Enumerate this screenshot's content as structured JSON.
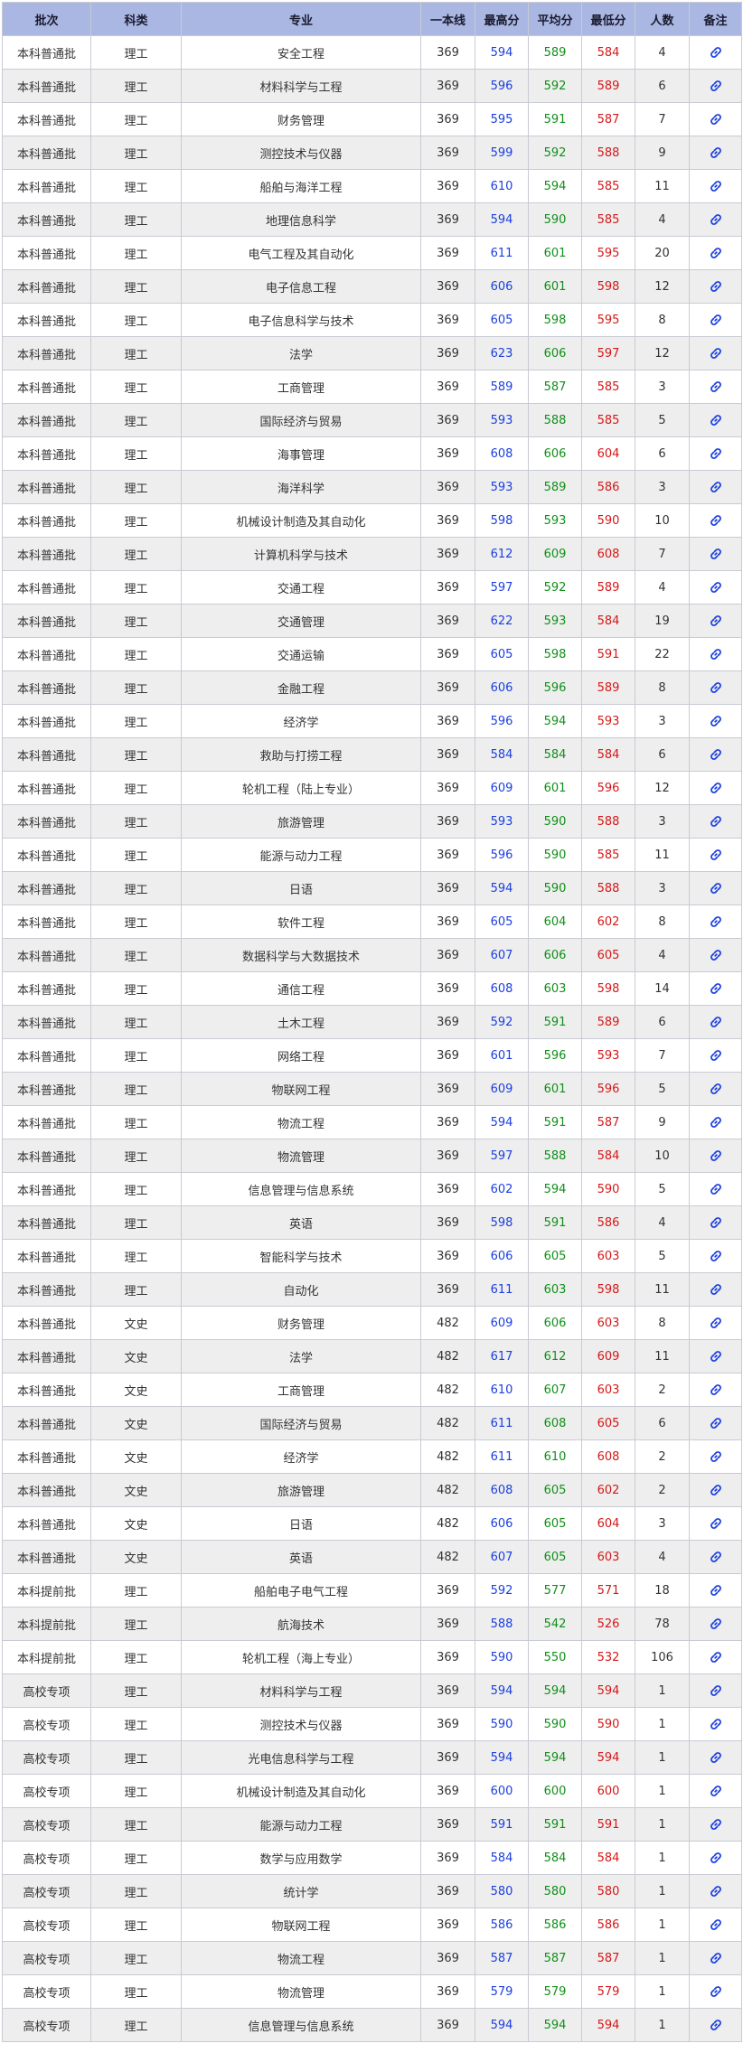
{
  "table": {
    "headers": {
      "batch": "批次",
      "category": "科类",
      "major": "专业",
      "line": "一本线",
      "max": "最高分",
      "avg": "平均分",
      "min": "最低分",
      "count": "人数",
      "note": "备注"
    },
    "rows": [
      {
        "batch": "本科普通批",
        "category": "理工",
        "major": "安全工程",
        "line": "369",
        "max": "594",
        "avg": "589",
        "min": "584",
        "count": "4"
      },
      {
        "batch": "本科普通批",
        "category": "理工",
        "major": "材料科学与工程",
        "line": "369",
        "max": "596",
        "avg": "592",
        "min": "589",
        "count": "6"
      },
      {
        "batch": "本科普通批",
        "category": "理工",
        "major": "财务管理",
        "line": "369",
        "max": "595",
        "avg": "591",
        "min": "587",
        "count": "7"
      },
      {
        "batch": "本科普通批",
        "category": "理工",
        "major": "测控技术与仪器",
        "line": "369",
        "max": "599",
        "avg": "592",
        "min": "588",
        "count": "9"
      },
      {
        "batch": "本科普通批",
        "category": "理工",
        "major": "船舶与海洋工程",
        "line": "369",
        "max": "610",
        "avg": "594",
        "min": "585",
        "count": "11"
      },
      {
        "batch": "本科普通批",
        "category": "理工",
        "major": "地理信息科学",
        "line": "369",
        "max": "594",
        "avg": "590",
        "min": "585",
        "count": "4"
      },
      {
        "batch": "本科普通批",
        "category": "理工",
        "major": "电气工程及其自动化",
        "line": "369",
        "max": "611",
        "avg": "601",
        "min": "595",
        "count": "20"
      },
      {
        "batch": "本科普通批",
        "category": "理工",
        "major": "电子信息工程",
        "line": "369",
        "max": "606",
        "avg": "601",
        "min": "598",
        "count": "12"
      },
      {
        "batch": "本科普通批",
        "category": "理工",
        "major": "电子信息科学与技术",
        "line": "369",
        "max": "605",
        "avg": "598",
        "min": "595",
        "count": "8"
      },
      {
        "batch": "本科普通批",
        "category": "理工",
        "major": "法学",
        "line": "369",
        "max": "623",
        "avg": "606",
        "min": "597",
        "count": "12"
      },
      {
        "batch": "本科普通批",
        "category": "理工",
        "major": "工商管理",
        "line": "369",
        "max": "589",
        "avg": "587",
        "min": "585",
        "count": "3"
      },
      {
        "batch": "本科普通批",
        "category": "理工",
        "major": "国际经济与贸易",
        "line": "369",
        "max": "593",
        "avg": "588",
        "min": "585",
        "count": "5"
      },
      {
        "batch": "本科普通批",
        "category": "理工",
        "major": "海事管理",
        "line": "369",
        "max": "608",
        "avg": "606",
        "min": "604",
        "count": "6"
      },
      {
        "batch": "本科普通批",
        "category": "理工",
        "major": "海洋科学",
        "line": "369",
        "max": "593",
        "avg": "589",
        "min": "586",
        "count": "3"
      },
      {
        "batch": "本科普通批",
        "category": "理工",
        "major": "机械设计制造及其自动化",
        "line": "369",
        "max": "598",
        "avg": "593",
        "min": "590",
        "count": "10"
      },
      {
        "batch": "本科普通批",
        "category": "理工",
        "major": "计算机科学与技术",
        "line": "369",
        "max": "612",
        "avg": "609",
        "min": "608",
        "count": "7"
      },
      {
        "batch": "本科普通批",
        "category": "理工",
        "major": "交通工程",
        "line": "369",
        "max": "597",
        "avg": "592",
        "min": "589",
        "count": "4"
      },
      {
        "batch": "本科普通批",
        "category": "理工",
        "major": "交通管理",
        "line": "369",
        "max": "622",
        "avg": "593",
        "min": "584",
        "count": "19"
      },
      {
        "batch": "本科普通批",
        "category": "理工",
        "major": "交通运输",
        "line": "369",
        "max": "605",
        "avg": "598",
        "min": "591",
        "count": "22"
      },
      {
        "batch": "本科普通批",
        "category": "理工",
        "major": "金融工程",
        "line": "369",
        "max": "606",
        "avg": "596",
        "min": "589",
        "count": "8"
      },
      {
        "batch": "本科普通批",
        "category": "理工",
        "major": "经济学",
        "line": "369",
        "max": "596",
        "avg": "594",
        "min": "593",
        "count": "3"
      },
      {
        "batch": "本科普通批",
        "category": "理工",
        "major": "救助与打捞工程",
        "line": "369",
        "max": "584",
        "avg": "584",
        "min": "584",
        "count": "6"
      },
      {
        "batch": "本科普通批",
        "category": "理工",
        "major": "轮机工程（陆上专业）",
        "line": "369",
        "max": "609",
        "avg": "601",
        "min": "596",
        "count": "12"
      },
      {
        "batch": "本科普通批",
        "category": "理工",
        "major": "旅游管理",
        "line": "369",
        "max": "593",
        "avg": "590",
        "min": "588",
        "count": "3"
      },
      {
        "batch": "本科普通批",
        "category": "理工",
        "major": "能源与动力工程",
        "line": "369",
        "max": "596",
        "avg": "590",
        "min": "585",
        "count": "11"
      },
      {
        "batch": "本科普通批",
        "category": "理工",
        "major": "日语",
        "line": "369",
        "max": "594",
        "avg": "590",
        "min": "588",
        "count": "3"
      },
      {
        "batch": "本科普通批",
        "category": "理工",
        "major": "软件工程",
        "line": "369",
        "max": "605",
        "avg": "604",
        "min": "602",
        "count": "8"
      },
      {
        "batch": "本科普通批",
        "category": "理工",
        "major": "数据科学与大数据技术",
        "line": "369",
        "max": "607",
        "avg": "606",
        "min": "605",
        "count": "4"
      },
      {
        "batch": "本科普通批",
        "category": "理工",
        "major": "通信工程",
        "line": "369",
        "max": "608",
        "avg": "603",
        "min": "598",
        "count": "14"
      },
      {
        "batch": "本科普通批",
        "category": "理工",
        "major": "土木工程",
        "line": "369",
        "max": "592",
        "avg": "591",
        "min": "589",
        "count": "6"
      },
      {
        "batch": "本科普通批",
        "category": "理工",
        "major": "网络工程",
        "line": "369",
        "max": "601",
        "avg": "596",
        "min": "593",
        "count": "7"
      },
      {
        "batch": "本科普通批",
        "category": "理工",
        "major": "物联网工程",
        "line": "369",
        "max": "609",
        "avg": "601",
        "min": "596",
        "count": "5"
      },
      {
        "batch": "本科普通批",
        "category": "理工",
        "major": "物流工程",
        "line": "369",
        "max": "594",
        "avg": "591",
        "min": "587",
        "count": "9"
      },
      {
        "batch": "本科普通批",
        "category": "理工",
        "major": "物流管理",
        "line": "369",
        "max": "597",
        "avg": "588",
        "min": "584",
        "count": "10"
      },
      {
        "batch": "本科普通批",
        "category": "理工",
        "major": "信息管理与信息系统",
        "line": "369",
        "max": "602",
        "avg": "594",
        "min": "590",
        "count": "5"
      },
      {
        "batch": "本科普通批",
        "category": "理工",
        "major": "英语",
        "line": "369",
        "max": "598",
        "avg": "591",
        "min": "586",
        "count": "4"
      },
      {
        "batch": "本科普通批",
        "category": "理工",
        "major": "智能科学与技术",
        "line": "369",
        "max": "606",
        "avg": "605",
        "min": "603",
        "count": "5"
      },
      {
        "batch": "本科普通批",
        "category": "理工",
        "major": "自动化",
        "line": "369",
        "max": "611",
        "avg": "603",
        "min": "598",
        "count": "11"
      },
      {
        "batch": "本科普通批",
        "category": "文史",
        "major": "财务管理",
        "line": "482",
        "max": "609",
        "avg": "606",
        "min": "603",
        "count": "8"
      },
      {
        "batch": "本科普通批",
        "category": "文史",
        "major": "法学",
        "line": "482",
        "max": "617",
        "avg": "612",
        "min": "609",
        "count": "11"
      },
      {
        "batch": "本科普通批",
        "category": "文史",
        "major": "工商管理",
        "line": "482",
        "max": "610",
        "avg": "607",
        "min": "603",
        "count": "2"
      },
      {
        "batch": "本科普通批",
        "category": "文史",
        "major": "国际经济与贸易",
        "line": "482",
        "max": "611",
        "avg": "608",
        "min": "605",
        "count": "6"
      },
      {
        "batch": "本科普通批",
        "category": "文史",
        "major": "经济学",
        "line": "482",
        "max": "611",
        "avg": "610",
        "min": "608",
        "count": "2"
      },
      {
        "batch": "本科普通批",
        "category": "文史",
        "major": "旅游管理",
        "line": "482",
        "max": "608",
        "avg": "605",
        "min": "602",
        "count": "2"
      },
      {
        "batch": "本科普通批",
        "category": "文史",
        "major": "日语",
        "line": "482",
        "max": "606",
        "avg": "605",
        "min": "604",
        "count": "3"
      },
      {
        "batch": "本科普通批",
        "category": "文史",
        "major": "英语",
        "line": "482",
        "max": "607",
        "avg": "605",
        "min": "603",
        "count": "4"
      },
      {
        "batch": "本科提前批",
        "category": "理工",
        "major": "船舶电子电气工程",
        "line": "369",
        "max": "592",
        "avg": "577",
        "min": "571",
        "count": "18"
      },
      {
        "batch": "本科提前批",
        "category": "理工",
        "major": "航海技术",
        "line": "369",
        "max": "588",
        "avg": "542",
        "min": "526",
        "count": "78"
      },
      {
        "batch": "本科提前批",
        "category": "理工",
        "major": "轮机工程（海上专业）",
        "line": "369",
        "max": "590",
        "avg": "550",
        "min": "532",
        "count": "106"
      },
      {
        "batch": "高校专项",
        "category": "理工",
        "major": "材料科学与工程",
        "line": "369",
        "max": "594",
        "avg": "594",
        "min": "594",
        "count": "1"
      },
      {
        "batch": "高校专项",
        "category": "理工",
        "major": "测控技术与仪器",
        "line": "369",
        "max": "590",
        "avg": "590",
        "min": "590",
        "count": "1"
      },
      {
        "batch": "高校专项",
        "category": "理工",
        "major": "光电信息科学与工程",
        "line": "369",
        "max": "594",
        "avg": "594",
        "min": "594",
        "count": "1"
      },
      {
        "batch": "高校专项",
        "category": "理工",
        "major": "机械设计制造及其自动化",
        "line": "369",
        "max": "600",
        "avg": "600",
        "min": "600",
        "count": "1"
      },
      {
        "batch": "高校专项",
        "category": "理工",
        "major": "能源与动力工程",
        "line": "369",
        "max": "591",
        "avg": "591",
        "min": "591",
        "count": "1"
      },
      {
        "batch": "高校专项",
        "category": "理工",
        "major": "数学与应用数学",
        "line": "369",
        "max": "584",
        "avg": "584",
        "min": "584",
        "count": "1"
      },
      {
        "batch": "高校专项",
        "category": "理工",
        "major": "统计学",
        "line": "369",
        "max": "580",
        "avg": "580",
        "min": "580",
        "count": "1"
      },
      {
        "batch": "高校专项",
        "category": "理工",
        "major": "物联网工程",
        "line": "369",
        "max": "586",
        "avg": "586",
        "min": "586",
        "count": "1"
      },
      {
        "batch": "高校专项",
        "category": "理工",
        "major": "物流工程",
        "line": "369",
        "max": "587",
        "avg": "587",
        "min": "587",
        "count": "1"
      },
      {
        "batch": "高校专项",
        "category": "理工",
        "major": "物流管理",
        "line": "369",
        "max": "579",
        "avg": "579",
        "min": "579",
        "count": "1"
      },
      {
        "batch": "高校专项",
        "category": "理工",
        "major": "信息管理与信息系统",
        "line": "369",
        "max": "594",
        "avg": "594",
        "min": "594",
        "count": "1"
      }
    ]
  },
  "colors": {
    "header_bg": "#aab7e3",
    "max_score": "#1b3fe0",
    "avg_score": "#109018",
    "min_score": "#d61818",
    "link_icon": "#1b3fe0"
  },
  "icons": {
    "note": "link-icon"
  }
}
